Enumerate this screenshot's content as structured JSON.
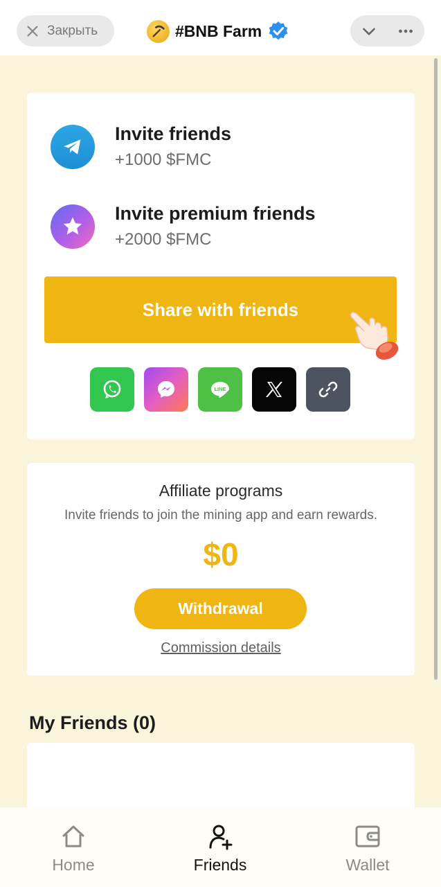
{
  "header": {
    "close_label": "Закрыть",
    "title": "#BNB Farm"
  },
  "invite": {
    "items": [
      {
        "title": "Invite friends",
        "reward": "+1000 $FMC",
        "icon": "telegram-icon"
      },
      {
        "title": "Invite premium friends",
        "reward": "+2000 $FMC",
        "icon": "premium-star-icon"
      }
    ],
    "share_label": "Share with friends",
    "social": [
      "whatsapp-icon",
      "messenger-icon",
      "line-icon",
      "x-icon",
      "link-icon"
    ],
    "line_text": "LINE"
  },
  "affiliate": {
    "title": "Affiliate programs",
    "subtitle": "Invite friends to join the mining app and earn rewards.",
    "amount": "$0",
    "withdraw_label": "Withdrawal",
    "commission_label": "Commission details"
  },
  "friends": {
    "heading": "My Friends (0)"
  },
  "nav": {
    "items": [
      {
        "label": "Home",
        "icon": "home-icon"
      },
      {
        "label": "Friends",
        "icon": "add-friend-icon"
      },
      {
        "label": "Wallet",
        "icon": "wallet-icon"
      }
    ],
    "active": "Friends"
  },
  "colors": {
    "accent": "#efb512",
    "page_bg": "#f9f4da"
  }
}
